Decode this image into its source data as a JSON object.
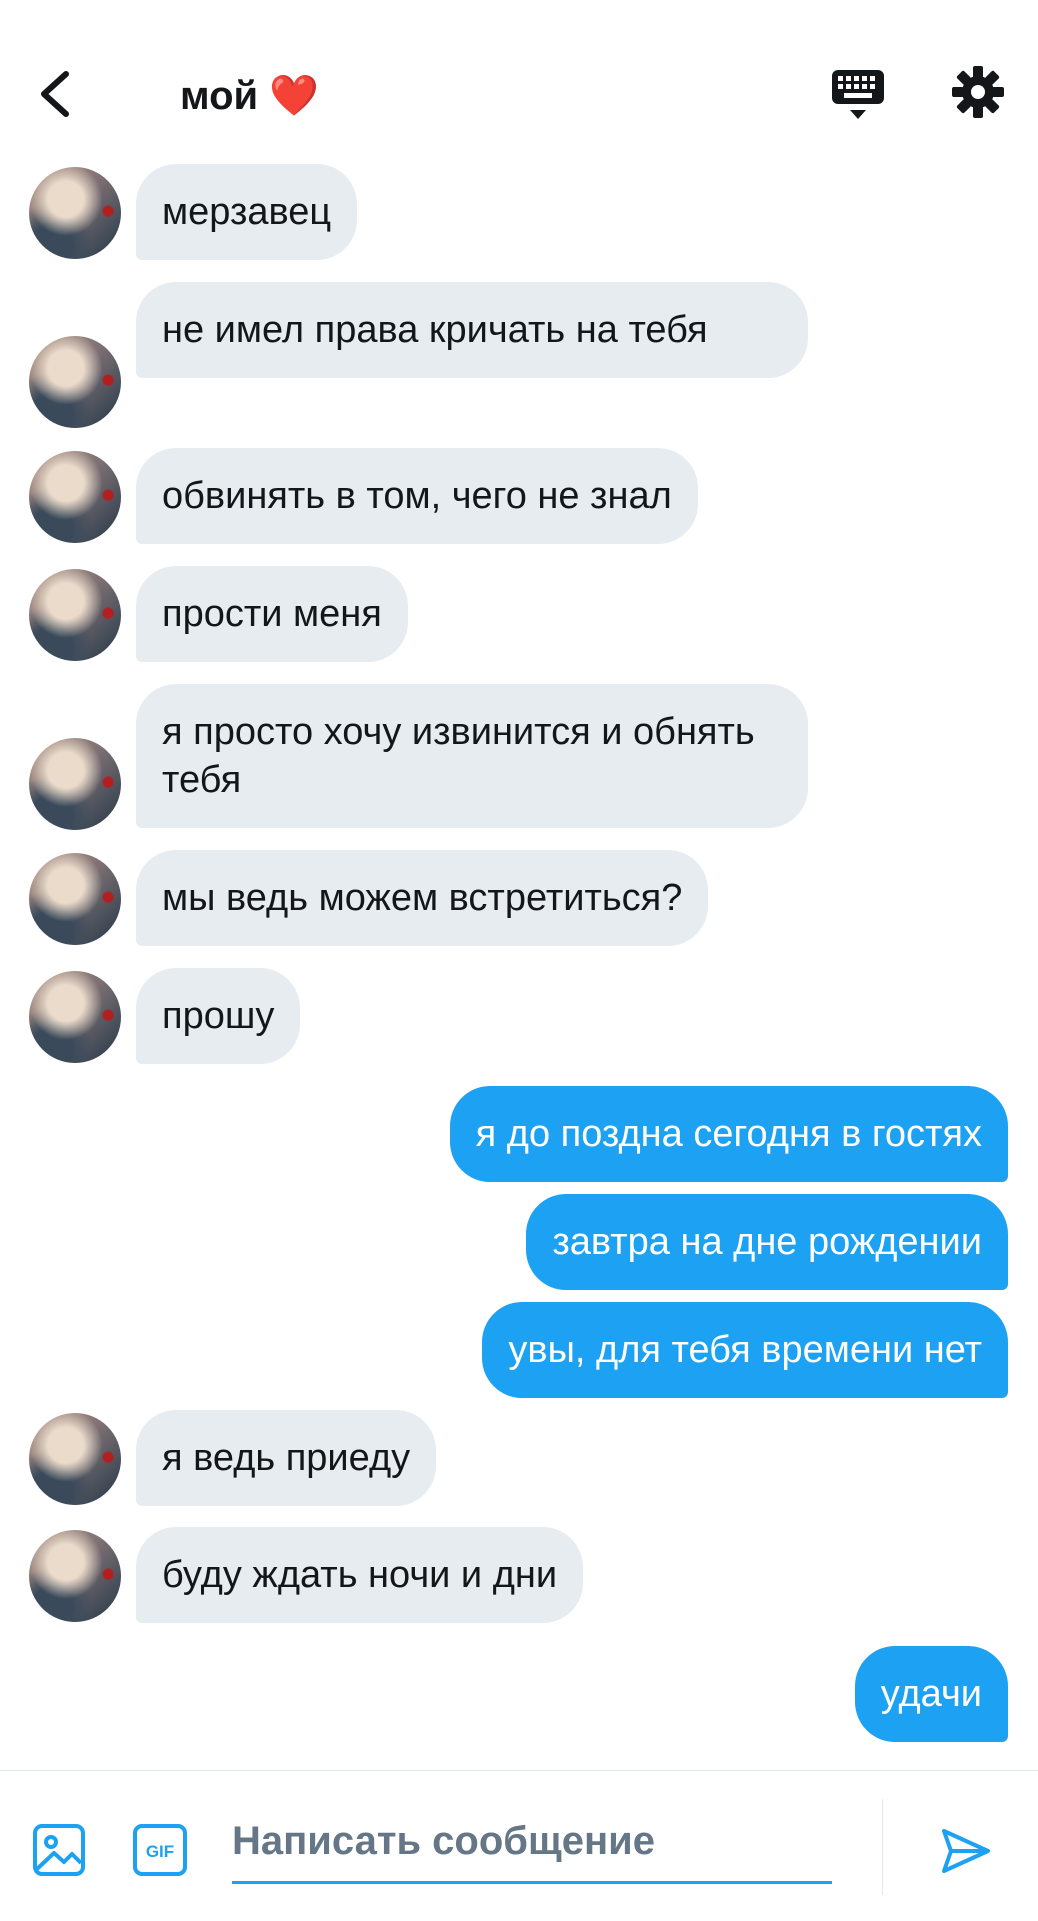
{
  "header": {
    "title": "мой ❤️"
  },
  "messages": [
    {
      "dir": "in",
      "text": "мерзавец"
    },
    {
      "dir": "in",
      "text": "не имел права кричать на тебя"
    },
    {
      "dir": "in",
      "text": "обвинять в том, чего не знал"
    },
    {
      "dir": "in",
      "text": "прости меня"
    },
    {
      "dir": "in",
      "text": "я просто хочу извинится и обнять тебя"
    },
    {
      "dir": "in",
      "text": "мы ведь можем встретиться?"
    },
    {
      "dir": "in",
      "text": "прошу"
    },
    {
      "dir": "out",
      "text": "я до поздна сегодня в гостях"
    },
    {
      "dir": "out",
      "text": "завтра на дне рождении"
    },
    {
      "dir": "out",
      "text": "увы, для тебя времени нет"
    },
    {
      "dir": "in",
      "text": "я ведь приеду"
    },
    {
      "dir": "in",
      "text": "буду ждать ночи и дни"
    },
    {
      "dir": "out",
      "text": "удачи"
    }
  ],
  "composer": {
    "placeholder": "Написать сообщение",
    "gif_label": "GIF"
  },
  "colors": {
    "accent": "#1da1f2",
    "incoming_bubble": "#e6ecf0",
    "text": "#14171a"
  }
}
